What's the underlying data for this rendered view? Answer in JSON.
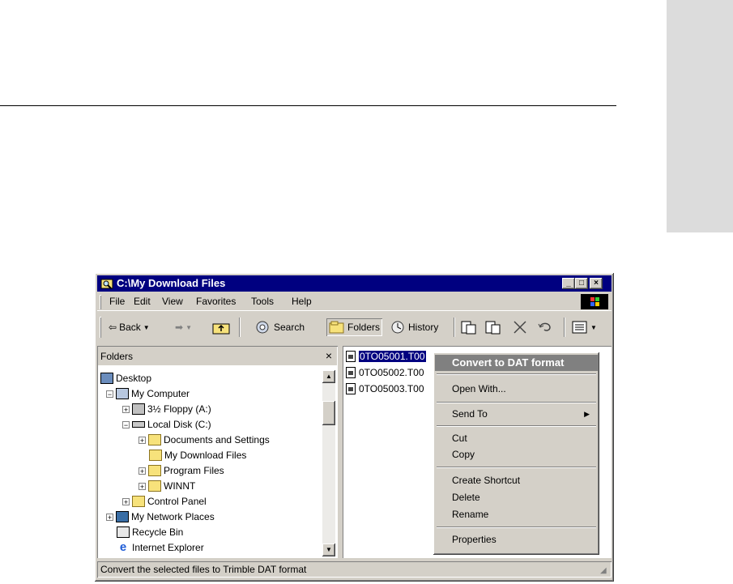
{
  "window": {
    "title": "C:\\My Download Files",
    "controls": {
      "minimize": "_",
      "maximize": "□",
      "close": "×"
    }
  },
  "menubar": [
    "File",
    "Edit",
    "View",
    "Favorites",
    "Tools",
    "Help"
  ],
  "toolbar": {
    "back": "Back",
    "search": "Search",
    "folders": "Folders",
    "history": "History"
  },
  "folders_pane": {
    "header": "Folders",
    "close": "×",
    "tree": [
      {
        "label": "Desktop",
        "icon": "desktop-icon"
      },
      {
        "label": "My Computer",
        "icon": "computer-icon"
      },
      {
        "label": "3½ Floppy (A:)",
        "icon": "floppy-icon"
      },
      {
        "label": "Local Disk (C:)",
        "icon": "drive-icon"
      },
      {
        "label": "Documents and Settings",
        "icon": "folder-icon"
      },
      {
        "label": "My Download Files",
        "icon": "open-folder-icon"
      },
      {
        "label": "Program Files",
        "icon": "folder-icon"
      },
      {
        "label": "WINNT",
        "icon": "folder-icon"
      },
      {
        "label": "Control Panel",
        "icon": "control-panel-icon"
      },
      {
        "label": "My Network Places",
        "icon": "network-icon"
      },
      {
        "label": "Recycle Bin",
        "icon": "recycle-bin-icon"
      },
      {
        "label": "Internet Explorer",
        "icon": "ie-icon"
      }
    ]
  },
  "files": [
    "0TO05001.T00",
    "0TO05002.T00",
    "0TO05003.T00"
  ],
  "context_menu": {
    "convert": "Convert to DAT format",
    "open_with": "Open With...",
    "send_to": "Send To",
    "cut": "Cut",
    "copy": "Copy",
    "create_shortcut": "Create Shortcut",
    "delete": "Delete",
    "rename": "Rename",
    "properties": "Properties"
  },
  "status_bar": "Convert the selected files to Trimble DAT format",
  "colors": {
    "titlebar": "#000080",
    "face": "#d4d0c8",
    "highlight": "#808080"
  }
}
